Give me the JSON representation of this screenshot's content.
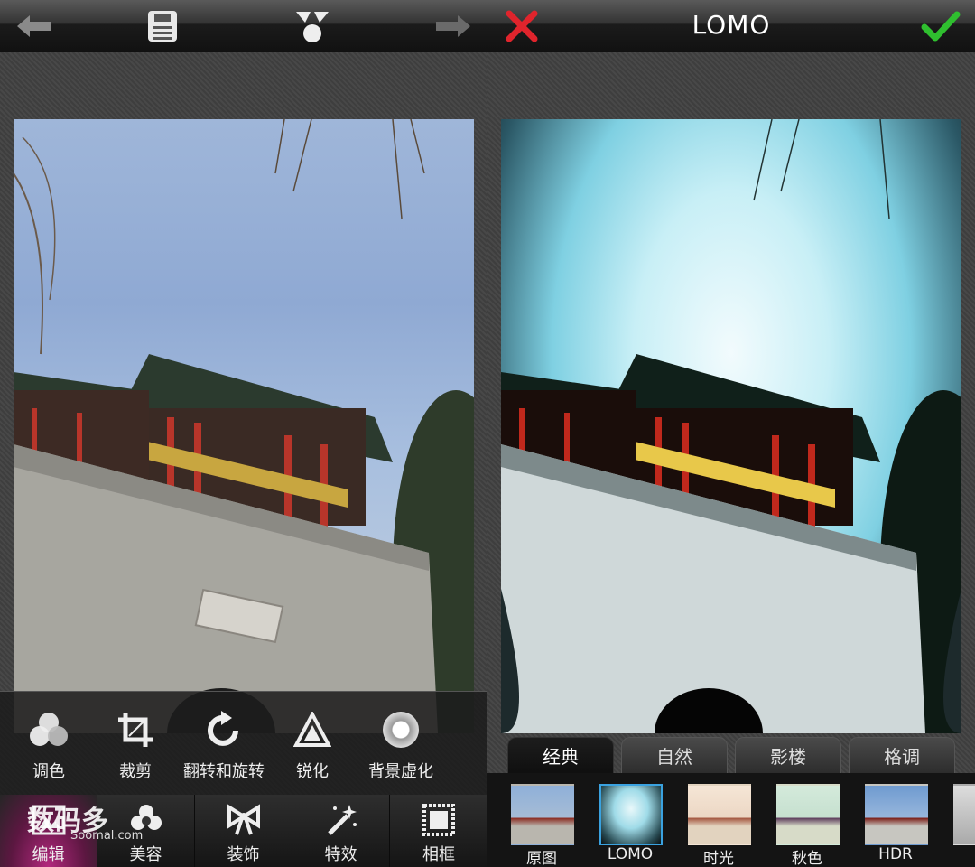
{
  "left_panel": {
    "toolbar": {
      "icons": [
        "undo-icon",
        "save-icon",
        "share-icon",
        "redo-icon"
      ]
    },
    "tools": [
      {
        "icon": "color-adjust-icon",
        "label": "调色"
      },
      {
        "icon": "crop-icon",
        "label": "裁剪"
      },
      {
        "icon": "rotate-icon",
        "label": "翻转和旋转"
      },
      {
        "icon": "sharpen-icon",
        "label": "锐化"
      },
      {
        "icon": "background-blur-icon",
        "label": "背景虚化"
      }
    ],
    "nav": [
      {
        "icon": "edit-icon",
        "label": "编辑",
        "active": true
      },
      {
        "icon": "beauty-icon",
        "label": "美容"
      },
      {
        "icon": "decoration-icon",
        "label": "装饰"
      },
      {
        "icon": "effects-icon",
        "label": "特效"
      },
      {
        "icon": "frame-icon",
        "label": "相框"
      }
    ],
    "watermark": {
      "text": "数码多",
      "url": "Soomal.com"
    }
  },
  "right_panel": {
    "title": "LOMO",
    "toolbar": {
      "cancel_icon": "close-icon",
      "confirm_icon": "check-icon"
    },
    "filter_tabs": [
      {
        "label": "经典",
        "active": true
      },
      {
        "label": "自然"
      },
      {
        "label": "影楼"
      },
      {
        "label": "格调"
      }
    ],
    "filters": [
      {
        "label": "原图"
      },
      {
        "label": "LOMO",
        "selected": true
      },
      {
        "label": "时光"
      },
      {
        "label": "秋色"
      },
      {
        "label": "HDR"
      }
    ]
  },
  "colors": {
    "accent_pink": "#b3287e",
    "selected_blue": "#3aa2e0",
    "cancel_red": "#e0242c",
    "confirm_green": "#2fbf2f"
  }
}
